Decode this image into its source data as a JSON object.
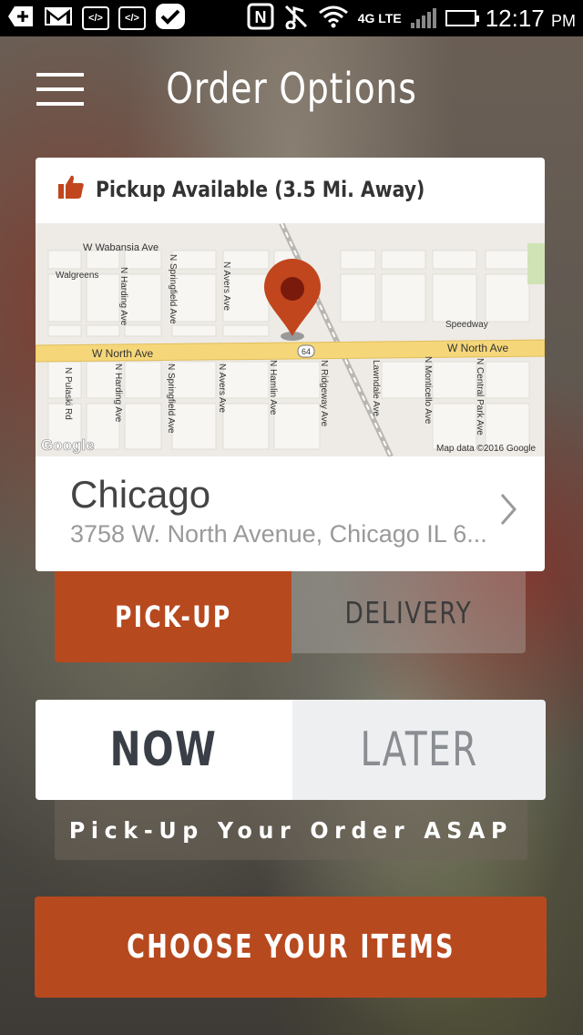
{
  "status_bar": {
    "icons": [
      "add-icon",
      "gmail-icon",
      "code-icon",
      "code-icon",
      "checkmark-icon",
      "nfc-icon",
      "mute-icon",
      "wifi-icon",
      "4g-lte-icon",
      "signal-icon",
      "battery-icon"
    ],
    "network": "4G LTE",
    "time": "12:17",
    "ampm": "PM"
  },
  "header": {
    "title": "Order Options",
    "menu_icon": "hamburger-menu-icon"
  },
  "pickup_card": {
    "availability": "Pickup Available (3.5 Mi. Away)",
    "availability_icon": "thumbs-up-icon",
    "map": {
      "streets": {
        "wabansia": "W Wabansia Ave",
        "north_left": "W North Ave",
        "north_right": "W North Ave",
        "harding_top": "N Harding Ave",
        "harding_bottom": "N Harding Ave",
        "springfield_top": "N Springfield Ave",
        "springfield_bottom": "N Springfield Ave",
        "avers_top": "N Avers Ave",
        "avers_bottom": "N Avers Ave",
        "pulaski": "N Pulaski Rd",
        "hamlin": "N Hamlin Ave",
        "ridgeway": "N Ridgeway Ave",
        "lawndale": "Lawndale Ave",
        "monticello": "N Monticello Ave",
        "central_park": "N Central Park Ave"
      },
      "poi_walgreens": "Walgreens",
      "poi_speedway": "Speedway",
      "route_shield": "64",
      "attribution": "Map data ©2016 Google",
      "logo": "Google"
    },
    "location_name": "Chicago",
    "location_address": "3758 W. North Avenue, Chicago IL 6...",
    "chevron_icon": "chevron-right-icon"
  },
  "order_type": {
    "pickup_label": "PICK-UP",
    "delivery_label": "DELIVERY",
    "selected": "PICK-UP"
  },
  "timing": {
    "now_label": "NOW",
    "later_label": "LATER",
    "selected": "NOW",
    "caption": "Pick-Up Your Order ASAP"
  },
  "cta": {
    "label": "CHOOSE YOUR ITEMS"
  },
  "colors": {
    "accent": "#b7491f",
    "map_road": "#f5d77a",
    "map_bg": "#eeebe6",
    "pin": "#c1461d"
  }
}
